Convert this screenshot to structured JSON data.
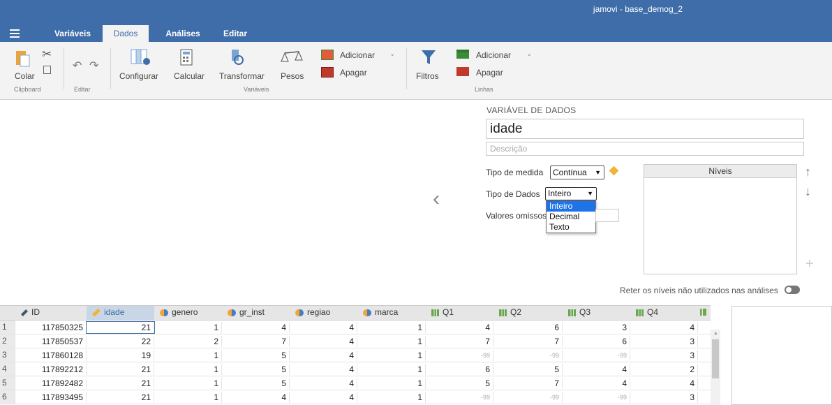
{
  "window": {
    "title": "jamovi - base_demog_2"
  },
  "tabs": [
    {
      "label": "Variáveis"
    },
    {
      "label": "Dados"
    },
    {
      "label": "Análises"
    },
    {
      "label": "Editar"
    }
  ],
  "ribbon": {
    "colar": "Colar",
    "clipboard_group": "Clipboard",
    "editar_group": "Editar",
    "configurar": "Configurar",
    "calcular": "Calcular",
    "transformar": "Transformar",
    "pesos": "Pesos",
    "variaveis_group": "Variáveis",
    "col_adicionar": "Adicionar",
    "col_apagar": "Apagar",
    "filtros": "Filtros",
    "row_adicionar": "Adicionar",
    "row_apagar": "Apagar",
    "linhas_group": "Linhas"
  },
  "editor": {
    "heading": "VARIÁVEL DE DADOS",
    "name_value": "idade",
    "description_placeholder": "Descrição",
    "measure_label": "Tipo de medida",
    "measure_value": "Contínua",
    "datatype_label": "Tipo de Dados",
    "datatype_value": "Inteiro",
    "datatype_options": [
      "Inteiro",
      "Decimal",
      "Texto"
    ],
    "missing_label": "Valores omissos",
    "levels_header": "Níveis",
    "retain_label": "Reter os níveis não utilizados nas análises"
  },
  "grid": {
    "columns": [
      "ID",
      "idade",
      "genero",
      "gr_inst",
      "regiao",
      "marca",
      "Q1",
      "Q2",
      "Q3",
      "Q4"
    ],
    "rows": [
      [
        "1",
        "117850325",
        "21",
        "1",
        "4",
        "4",
        "1",
        "4",
        "6",
        "3",
        "4"
      ],
      [
        "2",
        "117850537",
        "22",
        "2",
        "7",
        "4",
        "1",
        "7",
        "7",
        "6",
        "3"
      ],
      [
        "3",
        "117860128",
        "19",
        "1",
        "5",
        "4",
        "1",
        "-99",
        "-99",
        "-99",
        "3"
      ],
      [
        "4",
        "117892212",
        "21",
        "1",
        "5",
        "4",
        "1",
        "6",
        "5",
        "4",
        "2"
      ],
      [
        "5",
        "117892482",
        "21",
        "1",
        "5",
        "4",
        "1",
        "5",
        "7",
        "4",
        "4"
      ],
      [
        "6",
        "117893495",
        "21",
        "1",
        "4",
        "4",
        "1",
        "-99",
        "-99",
        "-99",
        "3"
      ]
    ]
  },
  "colors": {
    "brand": "#3e6da9",
    "highlight": "#1e73e8"
  }
}
